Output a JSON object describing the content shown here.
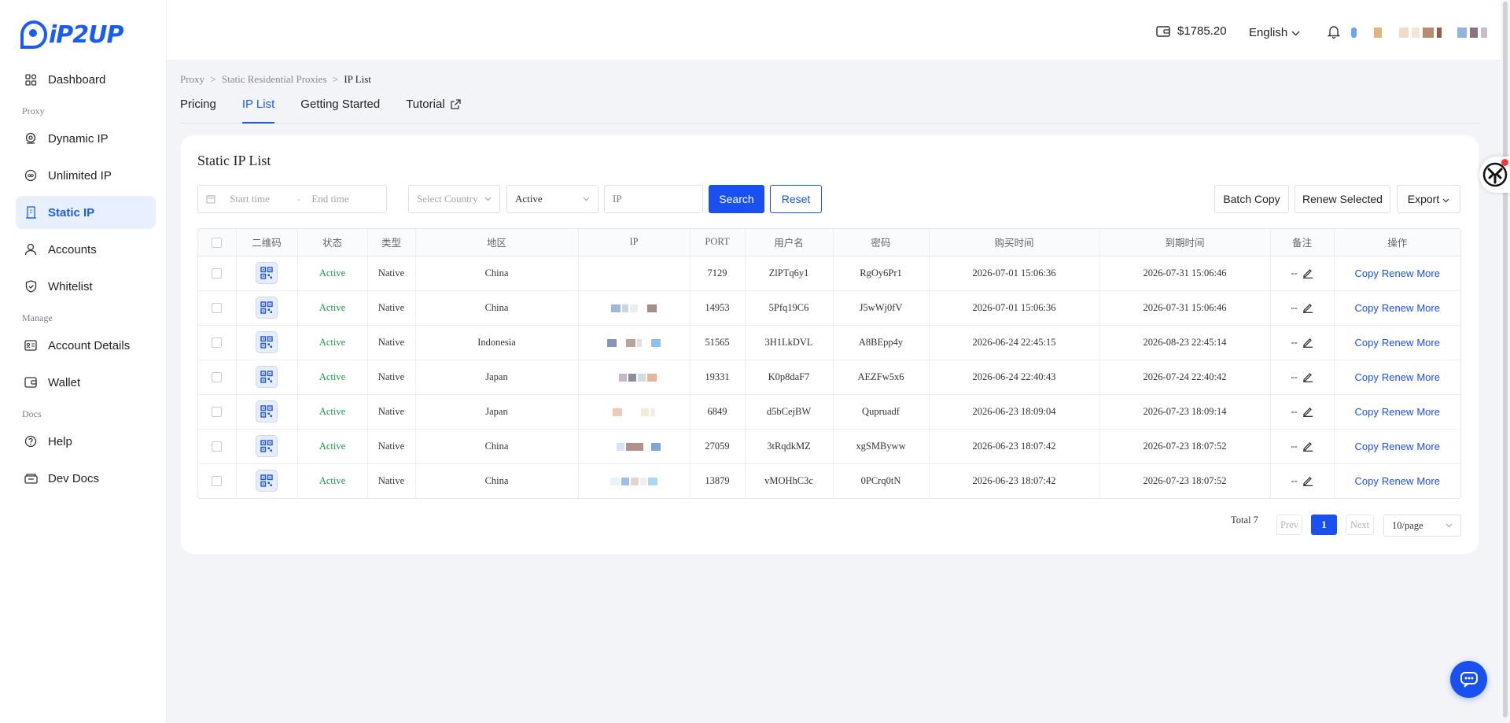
{
  "brand": {
    "logo_text": "iP2UP"
  },
  "sidebar": {
    "items": [
      {
        "label": "Dashboard",
        "icon": "grid-icon"
      },
      {
        "section": "Proxy"
      },
      {
        "label": "Dynamic IP",
        "icon": "location-icon"
      },
      {
        "label": "Unlimited IP",
        "icon": "infinity-icon"
      },
      {
        "label": "Static IP",
        "icon": "building-icon",
        "active": true
      },
      {
        "label": "Accounts",
        "icon": "user-icon"
      },
      {
        "label": "Whitelist",
        "icon": "shield-icon"
      },
      {
        "section": "Manage"
      },
      {
        "label": "Account Details",
        "icon": "id-card-icon"
      },
      {
        "label": "Wallet",
        "icon": "wallet-icon"
      },
      {
        "section": "Docs"
      },
      {
        "label": "Help",
        "icon": "help-icon"
      },
      {
        "label": "Dev Docs",
        "icon": "docs-icon"
      }
    ]
  },
  "header": {
    "balance": "$1785.20",
    "language": "English"
  },
  "breadcrumb": {
    "items": [
      "Proxy",
      "Static Residential Proxies",
      "IP List"
    ],
    "sep": ">"
  },
  "tabs": [
    {
      "label": "Pricing"
    },
    {
      "label": "IP List",
      "active": true
    },
    {
      "label": "Getting Started"
    },
    {
      "label": "Tutorial",
      "external": true
    }
  ],
  "card": {
    "title": "Static IP List",
    "filters": {
      "start_placeholder": "Start time",
      "end_placeholder": "End time",
      "date_sep": "-",
      "country_placeholder": "Select Country",
      "status_value": "Active",
      "ip_placeholder": "IP"
    },
    "buttons": {
      "search": "Search",
      "reset": "Reset",
      "batch_copy": "Batch Copy",
      "renew_selected": "Renew Selected",
      "export": "Export"
    },
    "table": {
      "headers": [
        "二维码",
        "状态",
        "类型",
        "地区",
        "IP",
        "PORT",
        "用户名",
        "密码",
        "购买时间",
        "到期时间",
        "备注",
        "操作"
      ],
      "rows": [
        {
          "status": "Active",
          "type": "Native",
          "region": "China",
          "port": "7129",
          "username": "ZlPTq6y1",
          "password": "RgOy6Pr1",
          "purchased": "2026-07-01 15:06:36",
          "expires": "2026-07-31 15:06:46",
          "remark": "--"
        },
        {
          "status": "Active",
          "type": "Native",
          "region": "China",
          "port": "14953",
          "username": "5Pfq19C6",
          "password": "J5wWj0fV",
          "purchased": "2026-07-01 15:06:36",
          "expires": "2026-07-31 15:06:46",
          "remark": "--"
        },
        {
          "status": "Active",
          "type": "Native",
          "region": "Indonesia",
          "port": "51565",
          "username": "3H1LkDVL",
          "password": "A8BEpp4y",
          "purchased": "2026-06-24 22:45:15",
          "expires": "2026-08-23 22:45:14",
          "remark": "--"
        },
        {
          "status": "Active",
          "type": "Native",
          "region": "Japan",
          "port": "19331",
          "username": "K0p8daF7",
          "password": "AEZFw5x6",
          "purchased": "2026-06-24 22:40:43",
          "expires": "2026-07-24 22:40:42",
          "remark": "--"
        },
        {
          "status": "Active",
          "type": "Native",
          "region": "Japan",
          "port": "6849",
          "username": "d5bCejBW",
          "password": "Qupruadf",
          "purchased": "2026-06-23 18:09:04",
          "expires": "2026-07-23 18:09:14",
          "remark": "--"
        },
        {
          "status": "Active",
          "type": "Native",
          "region": "China",
          "port": "27059",
          "username": "3tRqdkMZ",
          "password": "xgSMByww",
          "purchased": "2026-06-23 18:07:42",
          "expires": "2026-07-23 18:07:52",
          "remark": "--"
        },
        {
          "status": "Active",
          "type": "Native",
          "region": "China",
          "port": "13879",
          "username": "vMOHhC3c",
          "password": "0PCrq0tN",
          "purchased": "2026-06-23 18:07:42",
          "expires": "2026-07-23 18:07:52",
          "remark": "--"
        }
      ],
      "actions": {
        "copy": "Copy",
        "renew": "Renew",
        "more": "More"
      }
    },
    "pagination": {
      "total": "Total 7",
      "prev": "Prev",
      "page": "1",
      "next": "Next",
      "page_size": "10/page"
    }
  },
  "colors": {
    "accent": "#1a4ff0",
    "active_status": "#1a9d3f"
  }
}
